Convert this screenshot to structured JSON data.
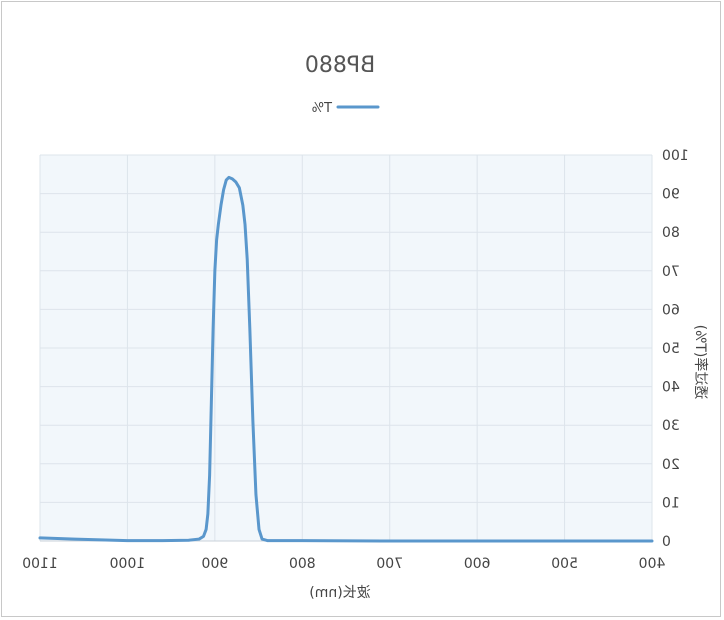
{
  "chart_data": {
    "type": "line",
    "title": "BP880",
    "xlabel": "波长(nm)",
    "ylabel": "透过率(T%)",
    "xlim": [
      400,
      1100
    ],
    "ylim": [
      0,
      100
    ],
    "x_ticks": [
      400,
      500,
      600,
      700,
      800,
      900,
      1000,
      1100
    ],
    "y_ticks": [
      0,
      10,
      20,
      30,
      40,
      50,
      60,
      70,
      80,
      90,
      100
    ],
    "x_axis_order": "descending",
    "y_axis_side": "right",
    "grid": true,
    "legend_position": "top-center",
    "plot_background": "#f2f7fb",
    "series": [
      {
        "name": "T%",
        "color": "#5a97cc",
        "points": [
          [
            400,
            0
          ],
          [
            500,
            0
          ],
          [
            600,
            0
          ],
          [
            700,
            0
          ],
          [
            800,
            0.1
          ],
          [
            840,
            0.1
          ],
          [
            846,
            0.5
          ],
          [
            849.5,
            3
          ],
          [
            853,
            12
          ],
          [
            856.5,
            31
          ],
          [
            860,
            55
          ],
          [
            863,
            73
          ],
          [
            865.5,
            82
          ],
          [
            868,
            87
          ],
          [
            872,
            91.5
          ],
          [
            876,
            93
          ],
          [
            880,
            93.8
          ],
          [
            884,
            94.2
          ],
          [
            887,
            93.5
          ],
          [
            890,
            91
          ],
          [
            893,
            87
          ],
          [
            896,
            82
          ],
          [
            898,
            78
          ],
          [
            900,
            70
          ],
          [
            902,
            55
          ],
          [
            904,
            36
          ],
          [
            906,
            17
          ],
          [
            908,
            7
          ],
          [
            910,
            3
          ],
          [
            913,
            1.2
          ],
          [
            918,
            0.5
          ],
          [
            930,
            0.2
          ],
          [
            960,
            0.1
          ],
          [
            1000,
            0.1
          ],
          [
            1030,
            0.3
          ],
          [
            1060,
            0.5
          ],
          [
            1100,
            0.8
          ]
        ]
      }
    ]
  }
}
